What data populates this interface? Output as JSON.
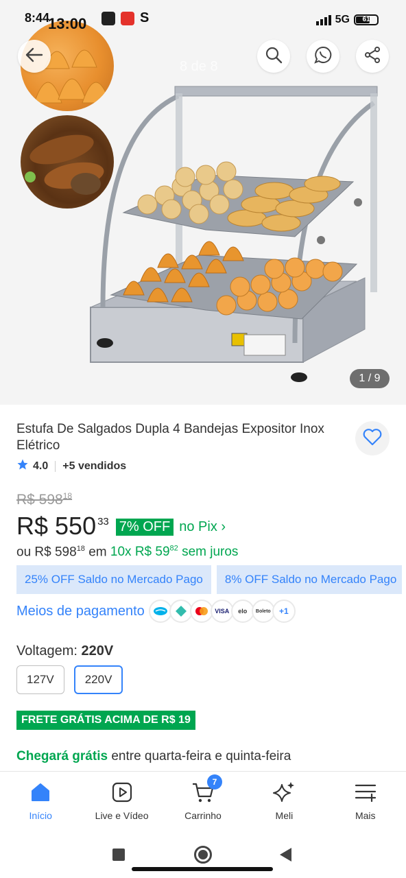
{
  "status": {
    "time": "8:44",
    "time_overlay": "13:00",
    "network": "5G",
    "battery": "61",
    "app_icon_letter": "S"
  },
  "gallery": {
    "page_indicator": "8 de 8",
    "counter": "1 / 9"
  },
  "icons": {
    "back": "arrow-left-icon",
    "search": "search-icon",
    "whatsapp": "whatsapp-icon",
    "share": "share-icon",
    "favorite": "heart-icon",
    "star": "star-icon"
  },
  "product": {
    "title": "Estufa De Salgados Dupla 4 Bandejas Expositor Inox Elétrico",
    "rating": "4.0",
    "rating_fill": 0.8,
    "sold": "+5 vendidos",
    "old_price": "R$ 598",
    "old_price_cents": "18",
    "price": "R$ 550",
    "price_cents": "33",
    "off_badge": "7% OFF",
    "pix_label": "no Pix ›",
    "installments_prefix": "ou R$ 598",
    "installments_prefix_cents": "18",
    "installments_em": "em",
    "installments_plan": "10x R$ 59",
    "installments_plan_cents": "82",
    "installments_suffix": "sem juros"
  },
  "promos": [
    "25% OFF Saldo no Mercado Pago",
    "8% OFF Saldo no Mercado Pago"
  ],
  "payments": {
    "label": "Meios de pagamento",
    "methods": [
      "",
      "",
      "",
      "VISA",
      "elo",
      "Boleto"
    ],
    "more": "+1"
  },
  "voltage": {
    "label": "Voltagem:",
    "selected": "220V",
    "options": [
      "127V",
      "220V"
    ]
  },
  "shipping": {
    "badge": "FRETE GRÁTIS ACIMA DE R$ 19",
    "delivery_highlight": "Chegará grátis",
    "delivery_text": "entre quarta-feira e quinta-feira"
  },
  "nav": {
    "items": [
      {
        "label": "Início",
        "icon": "home-icon"
      },
      {
        "label": "Live e Vídeo",
        "icon": "play-icon"
      },
      {
        "label": "Carrinho",
        "icon": "cart-icon"
      },
      {
        "label": "Meli",
        "icon": "sparkle-icon"
      },
      {
        "label": "Mais",
        "icon": "menu-icon"
      }
    ],
    "cart_count": "7"
  },
  "colors": {
    "accent_blue": "#3483fa",
    "green": "#00a650",
    "promo_bg": "#dbe8fa"
  }
}
